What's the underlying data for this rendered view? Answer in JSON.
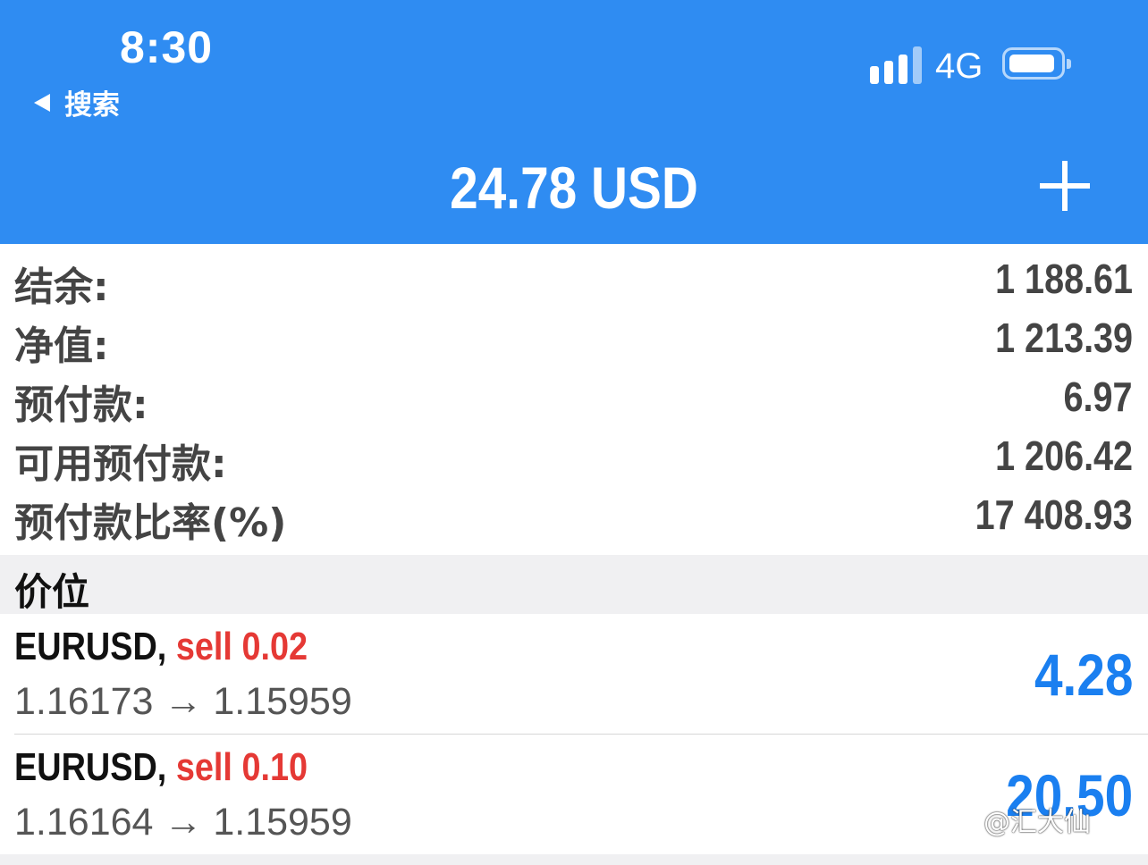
{
  "status_bar": {
    "time": "8:30",
    "back_label": "搜索",
    "network": "4G"
  },
  "header": {
    "title": "24.78 USD"
  },
  "summary": [
    {
      "label": "结余:",
      "value": "1 188.61"
    },
    {
      "label": "净值:",
      "value": "1 213.39"
    },
    {
      "label": "预付款:",
      "value": "6.97"
    },
    {
      "label": "可用预付款:",
      "value": "1 206.42"
    },
    {
      "label": "预付款比率(%)",
      "value": "17 408.93"
    }
  ],
  "positions_section": {
    "title": "价位",
    "positions": [
      {
        "symbol": "EURUSD,",
        "side": "sell 0.02",
        "prices": "1.16173 → 1.15959",
        "profit": "4.28"
      },
      {
        "symbol": "EURUSD,",
        "side": "sell 0.10",
        "prices": "1.16164 → 1.15959",
        "profit": "20.50"
      }
    ]
  },
  "watermark": "@汇大仙",
  "colors": {
    "header_bg": "#2f8cf2",
    "sell": "#e53935",
    "profit": "#1a7ff0"
  }
}
